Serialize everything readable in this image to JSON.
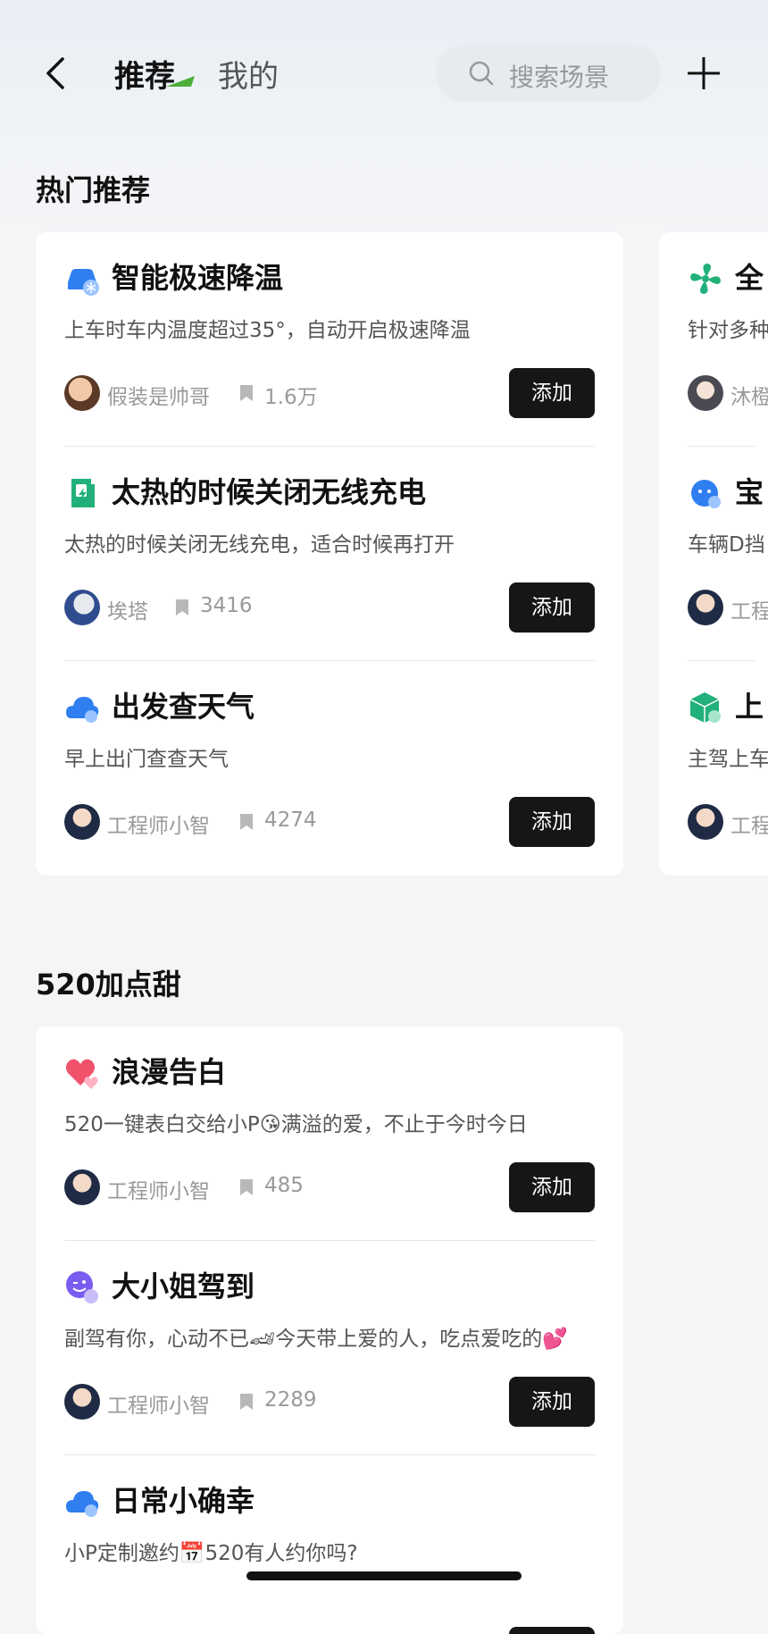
{
  "header": {
    "tabs": [
      {
        "label": "推荐",
        "active": true
      },
      {
        "label": "我的",
        "active": false
      }
    ],
    "search_placeholder": "搜索场景"
  },
  "sections": [
    {
      "title": "热门推荐",
      "cards": [
        [
          {
            "icon": "car-snowflake-icon",
            "title": "智能极速降温",
            "desc": "上车时车内温度超过35°，自动开启极速降温",
            "author": "假装是帅哥",
            "count": "1.6万",
            "button": "添加"
          },
          {
            "icon": "charger-icon",
            "title": "太热的时候关闭无线充电",
            "desc": "太热的时候关闭无线充电，适合时候再打开",
            "author": "埃塔",
            "count": "3416",
            "button": "添加"
          },
          {
            "icon": "cloud-weather-icon",
            "title": "出发查天气",
            "desc": "早上出门查查天气",
            "author": "工程师小智",
            "count": "4274",
            "button": "添加"
          }
        ],
        [
          {
            "icon": "fan-icon",
            "title": "全",
            "desc": "针对多种",
            "author": "沐橙",
            "count": "",
            "button": ""
          },
          {
            "icon": "baby-face-icon",
            "title": "宝",
            "desc": "车辆D挡",
            "author": "工程",
            "count": "",
            "button": ""
          },
          {
            "icon": "cube-icon",
            "title": "上",
            "desc": "主驾上车",
            "author": "工程",
            "count": "",
            "button": ""
          }
        ]
      ]
    },
    {
      "title": "520加点甜",
      "cards": [
        [
          {
            "icon": "hearts-icon",
            "title": "浪漫告白",
            "desc": "520一键表白交给小P😘满溢的爱，不止于今时今日",
            "author": "工程师小智",
            "count": "485",
            "button": "添加"
          },
          {
            "icon": "wink-face-icon",
            "title": "大小姐驾到",
            "desc": "副驾有你，心动不已🏎今天带上爱的人，吃点爱吃的💕",
            "author": "工程师小智",
            "count": "2289",
            "button": "添加"
          },
          {
            "icon": "cloud-weather-icon",
            "title": "日常小确幸",
            "desc": "小P定制邀约📅520有人约你吗?",
            "author": "",
            "count": "",
            "button": ""
          }
        ]
      ]
    }
  ],
  "colors": {
    "button_bg": "#161616",
    "accent_green": "#4cae3a",
    "icon_blue": "#2f7ff0",
    "icon_green": "#22b07a",
    "icon_pink": "#f0526c",
    "icon_purple": "#7b5cf0"
  }
}
